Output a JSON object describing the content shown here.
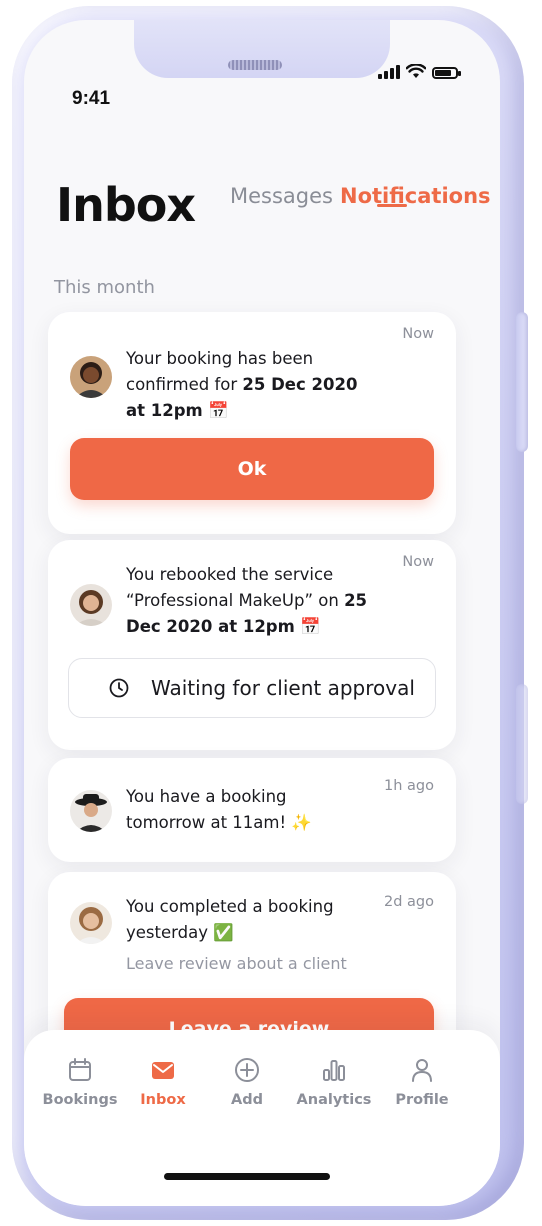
{
  "status": {
    "time": "9:41"
  },
  "header": {
    "title": "Inbox",
    "tabs": [
      {
        "label": "Messages",
        "active": false
      },
      {
        "label": "Notifications",
        "active": true
      }
    ]
  },
  "section_label": "This month",
  "notifications": [
    {
      "time": "Now",
      "text_prefix": "Your booking has been confirmed for ",
      "text_bold": "25 Dec 2020 at 12pm",
      "emoji": "📅",
      "action_label": "Ok"
    },
    {
      "time": "Now",
      "text_prefix": "You rebooked the service “Professional MakeUp” on ",
      "text_bold": "25 Dec 2020 at 12pm",
      "emoji": "📅",
      "status_text": "Waiting for client approval"
    },
    {
      "time": "1h ago",
      "text": "You have a booking tomorrow at 11am!",
      "emoji": "✨"
    },
    {
      "time": "2d ago",
      "text": "You completed a booking yesterday",
      "emoji": "✅",
      "subtext": "Leave review about a client",
      "action_label": "Leave a review"
    }
  ],
  "tabbar": {
    "items": [
      {
        "label": "Bookings",
        "icon": "calendar-icon",
        "active": false
      },
      {
        "label": "Inbox",
        "icon": "mail-icon",
        "active": true
      },
      {
        "label": "Add",
        "icon": "plus-circle-icon",
        "active": false
      },
      {
        "label": "Analytics",
        "icon": "bar-chart-icon",
        "active": false
      },
      {
        "label": "Profile",
        "icon": "user-icon",
        "active": false
      }
    ]
  },
  "colors": {
    "accent": "#EF6846",
    "frame": "#D4D5F4",
    "text": "#1A1A1F",
    "muted": "#8D909A"
  }
}
